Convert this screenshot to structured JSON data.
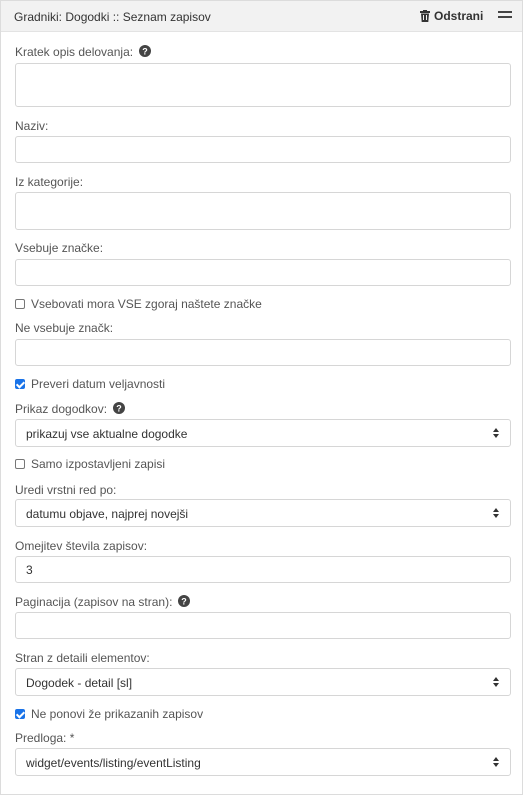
{
  "header": {
    "title": "Gradniki: Dogodki :: Seznam zapisov",
    "remove_label": "Odstrani"
  },
  "form": {
    "short_desc_label": "Kratek opis delovanja:",
    "name_label": "Naziv:",
    "category_label": "Iz kategorije:",
    "tags_label": "Vsebuje značke:",
    "all_tags_label": "Vsebovati mora VSE zgoraj naštete značke",
    "all_tags_checked": false,
    "exclude_tags_label": "Ne vsebuje značk:",
    "check_validity_label": "Preveri datum veljavnosti",
    "check_validity_checked": true,
    "display_label": "Prikaz dogodkov:",
    "display_value": "prikazuj vse aktualne dogodke",
    "featured_label": "Samo izpostavljeni zapisi",
    "featured_checked": false,
    "order_label": "Uredi vrstni red po:",
    "order_value": "datumu objave, najprej novejši",
    "limit_label": "Omejitev števila zapisov:",
    "limit_value": "3",
    "pagination_label": "Paginacija (zapisov na stran):",
    "detail_page_label": "Stran z detaili elementov:",
    "detail_page_value": "Dogodek - detail [sl]",
    "no_repeat_label": "Ne ponovi že prikazanih zapisov",
    "no_repeat_checked": true,
    "template_label": "Predloga: *",
    "template_value": "widget/events/listing/eventListing"
  },
  "icons": {
    "remove": "trash-icon",
    "menu": "hamburger-icon",
    "help": "question-circle-icon",
    "select": "sort-arrows-icon"
  }
}
